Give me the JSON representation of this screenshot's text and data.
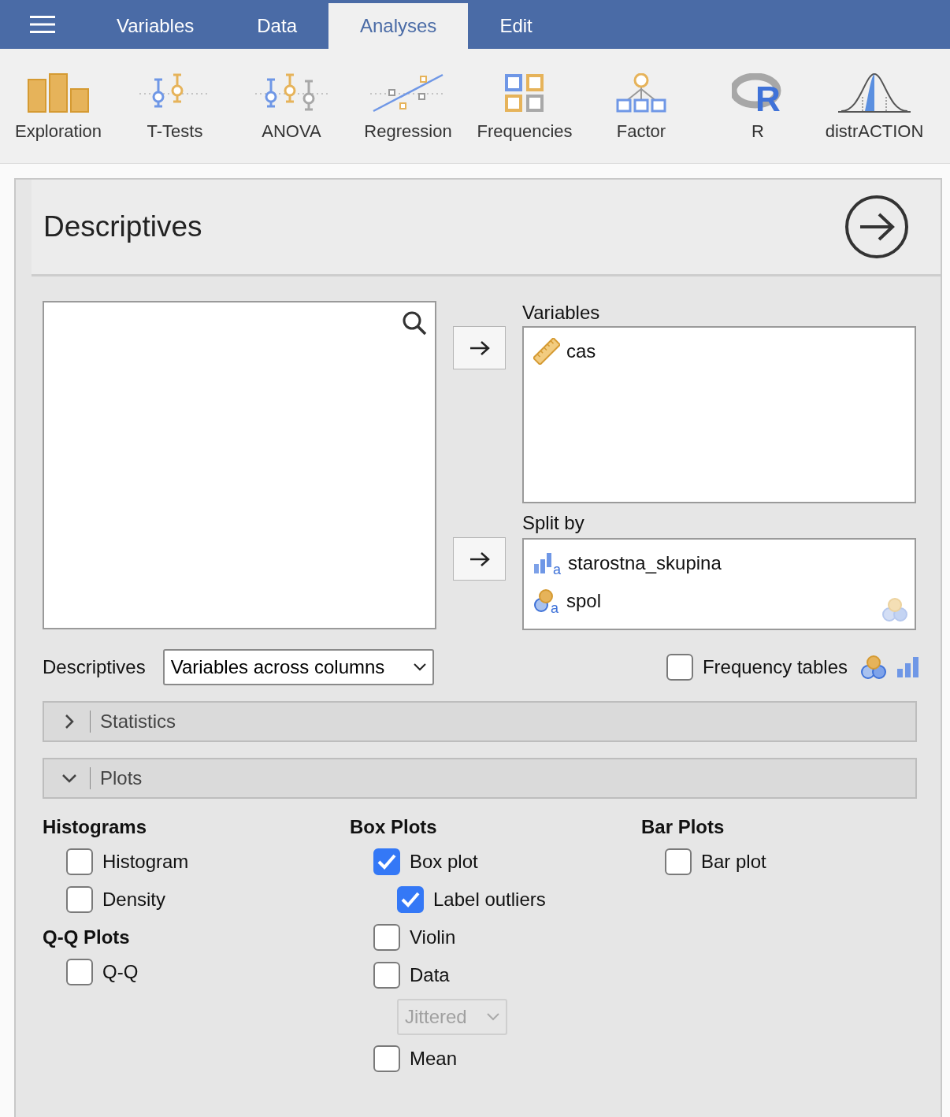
{
  "tabs": [
    {
      "label": "Variables",
      "selected": false
    },
    {
      "label": "Data",
      "selected": false
    },
    {
      "label": "Analyses",
      "selected": true
    },
    {
      "label": "Edit",
      "selected": false
    }
  ],
  "toolbar": [
    {
      "label": "Exploration",
      "kind": "exploration"
    },
    {
      "label": "T-Tests",
      "kind": "ttest"
    },
    {
      "label": "ANOVA",
      "kind": "anova"
    },
    {
      "label": "Regression",
      "kind": "regression"
    },
    {
      "label": "Frequencies",
      "kind": "frequencies"
    },
    {
      "label": "Factor",
      "kind": "factor"
    },
    {
      "label": "R",
      "kind": "r",
      "logo": "R"
    },
    {
      "label": "distrACTION",
      "kind": "distribution"
    }
  ],
  "analysis": {
    "title": "Descriptives",
    "variables": {
      "label": "Variables",
      "items": [
        {
          "name": "cas",
          "kind": "continuous"
        }
      ]
    },
    "split_by": {
      "label": "Split by",
      "items": [
        {
          "name": "starostna_skupina",
          "kind": "ordinal",
          "badge": "a"
        },
        {
          "name": "spol",
          "kind": "nominal",
          "badge": "a"
        }
      ]
    },
    "descriptives": {
      "label": "Descriptives",
      "value": "Variables across columns"
    },
    "frequency_tables": {
      "label": "Frequency tables",
      "checked": false
    },
    "sections": [
      {
        "label": "Statistics",
        "expanded": false
      },
      {
        "label": "Plots",
        "expanded": true
      }
    ],
    "plots": {
      "columns": [
        [
          {
            "heading": "Histograms",
            "options": [
              {
                "kind": "checkbox",
                "label": "Histogram",
                "checked": false
              },
              {
                "kind": "checkbox",
                "label": "Density",
                "checked": false
              }
            ]
          },
          {
            "heading": "Q-Q Plots",
            "options": [
              {
                "kind": "checkbox",
                "label": "Q-Q",
                "checked": false
              }
            ]
          }
        ],
        [
          {
            "heading": "Box Plots",
            "options": [
              {
                "kind": "checkbox",
                "label": "Box plot",
                "checked": true,
                "children": [
                  {
                    "kind": "checkbox",
                    "label": "Label outliers",
                    "checked": true
                  }
                ]
              },
              {
                "kind": "checkbox",
                "label": "Violin",
                "checked": false
              },
              {
                "kind": "checkbox",
                "label": "Data",
                "checked": false,
                "children": [
                  {
                    "kind": "dropdown",
                    "value": "Jittered",
                    "disabled": true
                  }
                ]
              },
              {
                "kind": "checkbox",
                "label": "Mean",
                "checked": false
              }
            ]
          }
        ],
        [
          {
            "heading": "Bar Plots",
            "options": [
              {
                "kind": "checkbox",
                "label": "Bar plot",
                "checked": false
              }
            ]
          }
        ]
      ]
    }
  }
}
